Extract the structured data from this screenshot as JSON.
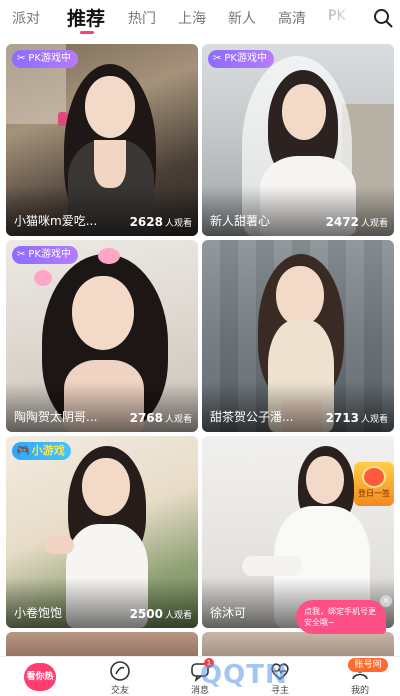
{
  "tabs": [
    "派对",
    "推荐",
    "热门",
    "上海",
    "新人",
    "高清",
    "PK"
  ],
  "active_tab": "推荐",
  "badges": {
    "pk": "PK游戏中",
    "game": "小游戏"
  },
  "viewers_unit": "人观看",
  "cards": [
    {
      "name": "小猫咪m爱吃...",
      "viewers": "2628",
      "badge": "pk"
    },
    {
      "name": "新人甜薯心",
      "viewers": "2472",
      "badge": "pk"
    },
    {
      "name": "陶陶贺太阴哥...",
      "viewers": "2768",
      "badge": "pk"
    },
    {
      "name": "甜茶贺公子潘...",
      "viewers": "2713",
      "badge": ""
    },
    {
      "name": "小卷饱饱",
      "viewers": "2500",
      "badge": "game"
    },
    {
      "name": "徐沐可",
      "viewers": "",
      "badge": ""
    }
  ],
  "promo": {
    "badge_text": "登日一签",
    "tip": "点我，绑定手机号更安全哦~",
    "close": "×"
  },
  "bottom_nav": {
    "home": "看你热",
    "friends": "交友",
    "messages": "消息",
    "messages_count": "1",
    "moments": "寻主",
    "mine": "我的",
    "mine_tag": "账号网"
  },
  "watermark": "QQTN",
  "colors": {
    "accent": "#ff3d78",
    "pk_badge": "#9a70ff",
    "game_badge": "#2ea7ff"
  }
}
